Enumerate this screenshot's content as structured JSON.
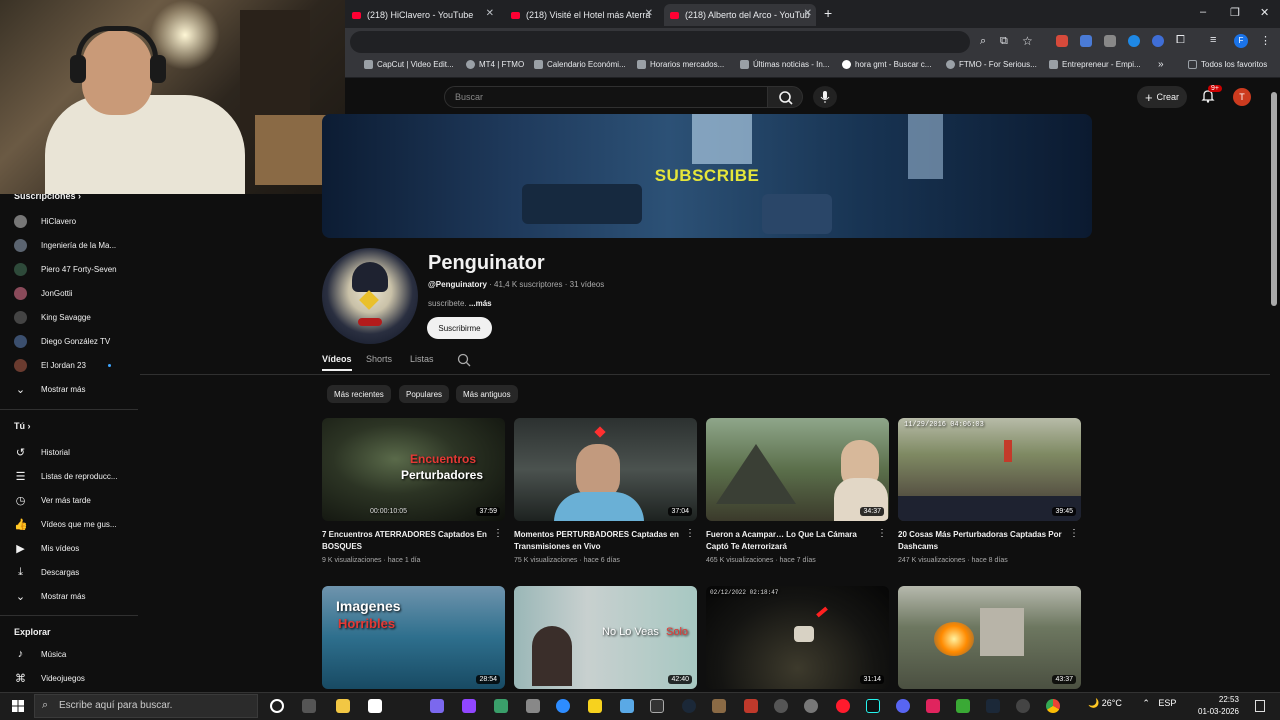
{
  "browser": {
    "tabs": [
      {
        "label": "(218) HiClavero - YouTube"
      },
      {
        "label": "(218) Visité el Hotel más Aterra"
      },
      {
        "label": "(218) Alberto del Arco - YouTub"
      }
    ],
    "new_tab": "+",
    "bookmarks": [
      {
        "label": "CapCut | Video Edit..."
      },
      {
        "label": "MT4 | FTMO"
      },
      {
        "label": "Calendario Económi..."
      },
      {
        "label": "Horarios mercados..."
      },
      {
        "label": "Últimas noticias - In..."
      },
      {
        "label": "hora gmt - Buscar c..."
      },
      {
        "label": "FTMO - For Serious..."
      },
      {
        "label": "Entrepreneur - Empi..."
      }
    ],
    "bookmarks_more": "»",
    "all_bookmarks": "Todos los favoritos",
    "profile_initial": "F"
  },
  "header": {
    "search_placeholder": "Buscar",
    "create_label": "Crear",
    "notif_count": "9+",
    "user_initial": "T"
  },
  "sidebar": {
    "subs_header": "Suscripciones",
    "subs": [
      {
        "label": "HiClavero"
      },
      {
        "label": "Ingeniería de la Ma..."
      },
      {
        "label": "Piero 47 Forty-Seven"
      },
      {
        "label": "JonGottii"
      },
      {
        "label": "King Savagge"
      },
      {
        "label": "Diego González TV"
      },
      {
        "label": "El Jordan 23"
      }
    ],
    "show_more_1": "Mostrar más",
    "you_header": "Tú",
    "you_items": [
      {
        "label": "Historial",
        "icon": "history-icon",
        "glyph": "↺"
      },
      {
        "label": "Listas de reproducc...",
        "icon": "playlist-icon",
        "glyph": "☰"
      },
      {
        "label": "Ver más tarde",
        "icon": "clock-icon",
        "glyph": "◷"
      },
      {
        "label": "Vídeos que me gus...",
        "icon": "thumbs-up-icon",
        "glyph": "👍"
      },
      {
        "label": "Mis vídeos",
        "icon": "my-videos-icon",
        "glyph": "▶"
      },
      {
        "label": "Descargas",
        "icon": "download-icon",
        "glyph": "⤓"
      }
    ],
    "show_more_2": "Mostrar más",
    "explore_header": "Explorar",
    "explore_items": [
      {
        "label": "Música",
        "icon": "music-icon",
        "glyph": "♪"
      },
      {
        "label": "Videojuegos",
        "icon": "gamepad-icon",
        "glyph": "⌘"
      }
    ]
  },
  "banner": {
    "text": "SUBSCRIBE"
  },
  "channel": {
    "name": "Penguinator",
    "handle": "@Penguinatory",
    "meta": " · 41,4 K suscriptores · 31 vídeos",
    "desc": "suscribete. ",
    "more": "...más",
    "subscribe_label": "Suscribirme"
  },
  "tabs": {
    "videos": "Vídeos",
    "shorts": "Shorts",
    "listas": "Listas"
  },
  "chips": [
    "Más recientes",
    "Populares",
    "Más antiguos"
  ],
  "videos": [
    {
      "title": "7 Encuentros ATERRADORES Captados En BOSQUES",
      "meta": "9 K visualizaciones · hace 1 día",
      "duration": "37:59",
      "overlay1": "Encuentros",
      "overlay2": "Perturbadores",
      "overlay3": "00:00:10:05"
    },
    {
      "title": "Momentos PERTURBADORES Captadas en Transmisiones en Vivo",
      "meta": "75 K visualizaciones · hace 6 días",
      "duration": "37:04"
    },
    {
      "title": "Fueron a Acampar… Lo Que La Cámara Captó Te Aterrorizará",
      "meta": "465 K visualizaciones · hace 7 días",
      "duration": "34:37"
    },
    {
      "title": "20 Cosas Más Perturbadoras Captadas Por Dashcams",
      "meta": "247 K visualizaciones · hace 8 días",
      "duration": "39:45",
      "overlay1": "11/29/2016 04:06:03"
    },
    {
      "duration": "28:54",
      "overlay1": "Imagenes",
      "overlay2": "Horribles"
    },
    {
      "duration": "42:40",
      "overlay1": "No Lo Veas",
      "overlay2": "Solo"
    },
    {
      "duration": "31:14",
      "overlay1": "02/12/2022 02:18:47"
    },
    {
      "duration": "43:37"
    }
  ],
  "taskbar": {
    "search_placeholder": "Escribe aquí para buscar.",
    "weather": "26°C",
    "lang": "ESP",
    "time": "22:53",
    "date": "01-03-2026"
  }
}
